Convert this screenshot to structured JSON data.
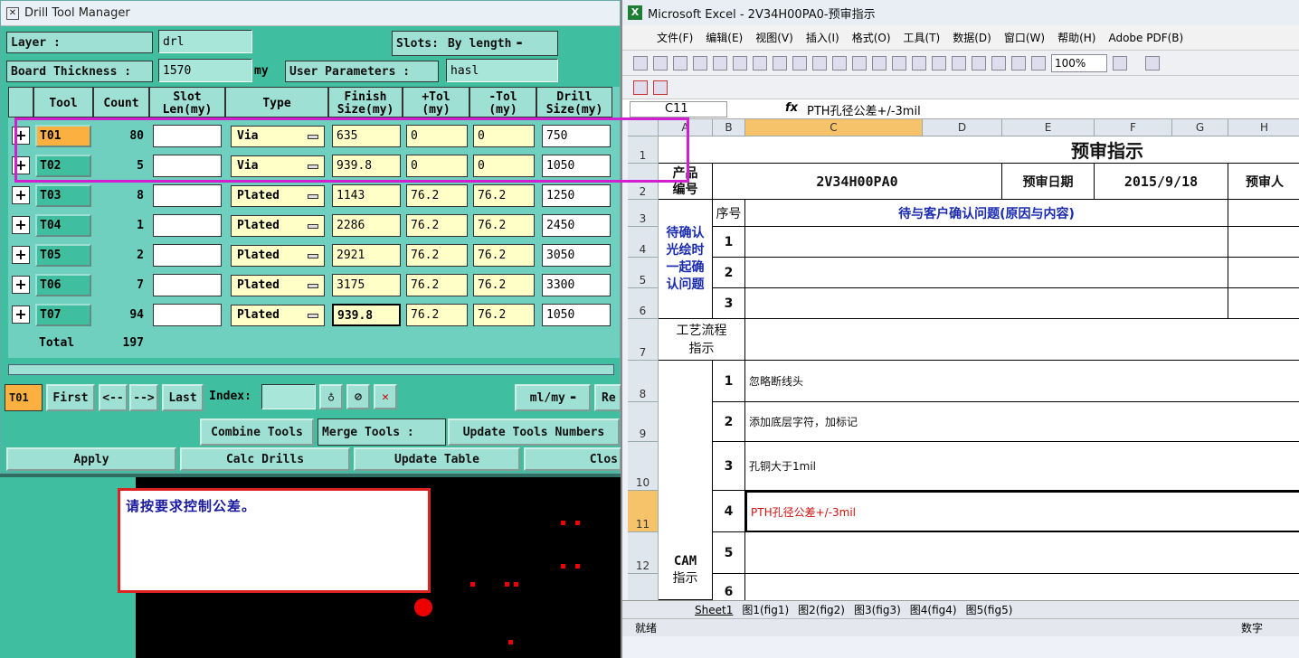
{
  "drill": {
    "title": "Drill Tool Manager",
    "layer_label": "Layer        :",
    "layer_value": "drl",
    "slots_label": "Slots:",
    "slots_value": "By length",
    "board_thickness_label": "Board Thickness :",
    "board_thickness_value": "1570",
    "board_thickness_unit": "my",
    "user_params_label": "User Parameters :",
    "user_params_value": "hasl",
    "columns": [
      "Tool",
      "Count",
      "Slot\nLen(my)",
      "Type",
      "Finish\nSize(my)",
      "+Tol\n(my)",
      "-Tol\n(my)",
      "Drill\nSize(my)"
    ],
    "rows": [
      {
        "tool": "T01",
        "count": "80",
        "type": "Via",
        "finish": "635",
        "ptol": "0",
        "ntol": "0",
        "drill": "750"
      },
      {
        "tool": "T02",
        "count": "5",
        "type": "Via",
        "finish": "939.8",
        "ptol": "0",
        "ntol": "0",
        "drill": "1050"
      },
      {
        "tool": "T03",
        "count": "8",
        "type": "Plated",
        "finish": "1143",
        "ptol": "76.2",
        "ntol": "76.2",
        "drill": "1250"
      },
      {
        "tool": "T04",
        "count": "1",
        "type": "Plated",
        "finish": "2286",
        "ptol": "76.2",
        "ntol": "76.2",
        "drill": "2450"
      },
      {
        "tool": "T05",
        "count": "2",
        "type": "Plated",
        "finish": "2921",
        "ptol": "76.2",
        "ntol": "76.2",
        "drill": "3050"
      },
      {
        "tool": "T06",
        "count": "7",
        "type": "Plated",
        "finish": "3175",
        "ptol": "76.2",
        "ntol": "76.2",
        "drill": "3300"
      },
      {
        "tool": "T07",
        "count": "94",
        "type": "Plated",
        "finish": "939.8",
        "ptol": "76.2",
        "ntol": "76.2",
        "drill": "1050"
      }
    ],
    "total_label": "Total",
    "total_value": "197",
    "current_tool": "T01",
    "nav": {
      "first": "First",
      "prev": "<--",
      "next": "-->",
      "last": "Last",
      "index_label": "Index:",
      "unit": "ml/my",
      "re": "Re"
    },
    "combine": "Combine Tools",
    "merge": "Merge Tools :",
    "update_numbers": "Update Tools Numbers",
    "apply": "Apply",
    "calc": "Calc Drills",
    "update_table": "Update Table",
    "close": "Clos"
  },
  "note": "请按要求控制公差。",
  "excel": {
    "title": "Microsoft Excel - 2V34H00PA0-预审指示",
    "menu": [
      "文件(F)",
      "编辑(E)",
      "视图(V)",
      "插入(I)",
      "格式(O)",
      "工具(T)",
      "数据(D)",
      "窗口(W)",
      "帮助(H)",
      "Adobe PDF(B)"
    ],
    "zoom": "100%",
    "name_box": "C11",
    "formula": "PTH孔径公差+/-3mil",
    "col_headers": [
      "A",
      "B",
      "C",
      "D",
      "E",
      "F",
      "G",
      "H"
    ],
    "row_headers": [
      "1",
      "2",
      "3",
      "4",
      "5",
      "6",
      "7",
      "8",
      "9",
      "10",
      "11",
      "12"
    ],
    "sheet_title": "预审指示",
    "product_label": "产品\n编号",
    "product_value": "2V34H00PA0",
    "date_label": "预审日期",
    "date_value": "2015/9/18",
    "reviewer_label": "预审人",
    "seq_label": "序号",
    "issues_header": "待与客户确认问题(原因与内容)",
    "confirm_label": "待确认\n光绘时\n一起确\n认问题",
    "issue_nums": [
      "1",
      "2",
      "3"
    ],
    "process_label": "工艺流程\n指示",
    "cam_label_1": "CAM",
    "cam_label_2": "指示",
    "cam_nums": [
      "1",
      "2",
      "3",
      "4",
      "5",
      "6"
    ],
    "cam_items": [
      "忽略断线头",
      "添加底层字符，加标记",
      "孔铜大于1mil",
      "PTH孔径公差+/-3mil",
      "",
      ""
    ],
    "tabs": [
      "Sheet1",
      "图1(fig1)",
      "图2(fig2)",
      "图3(fig3)",
      "图4(fig4)",
      "图5(fig5)"
    ],
    "status_left": "就绪",
    "status_right": "数字",
    "colors": {
      "cam_item_4": "#cc1111",
      "blue_header": "#1a2bb0"
    }
  }
}
